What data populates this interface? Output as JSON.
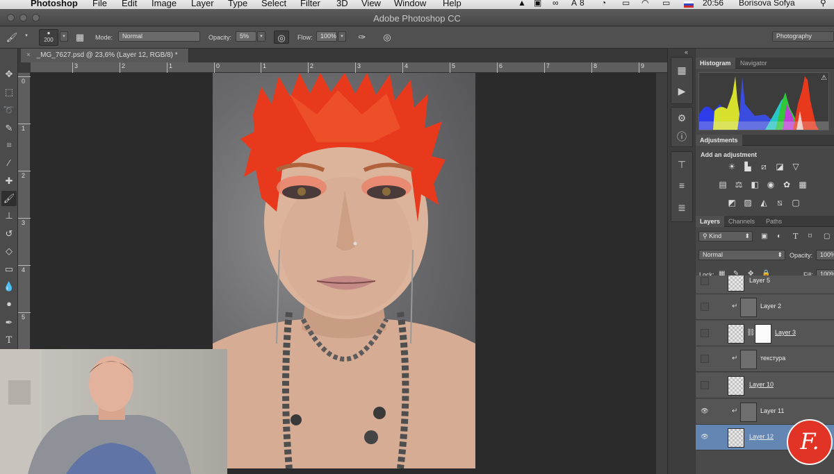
{
  "menubar": {
    "app_name": "Photoshop",
    "menus": [
      "File",
      "Edit",
      "Image",
      "Layer",
      "Type",
      "Select",
      "Filter",
      "3D",
      "View",
      "Window",
      "Help"
    ],
    "status": {
      "badge": "8",
      "time": "20:56",
      "user": "Borisova Sofya"
    }
  },
  "window": {
    "title": "Adobe Photoshop CC"
  },
  "options": {
    "brush_size": "200",
    "mode_label": "Mode:",
    "mode_value": "Normal",
    "opacity_label": "Opacity:",
    "opacity_value": "5%",
    "flow_label": "Flow:",
    "flow_value": "100%",
    "workspace": "Photography"
  },
  "document": {
    "tab_title": "_MG_7627.psd @ 23,6% (Layer 12, RGB/8) *",
    "close": "×"
  },
  "rulers": {
    "horizontal": [
      "3",
      "2",
      "1",
      "0",
      "1",
      "2",
      "3",
      "4",
      "5",
      "6",
      "7",
      "8",
      "9"
    ],
    "vertical": [
      "0",
      "1",
      "2",
      "3",
      "4",
      "5"
    ]
  },
  "tools": [
    "move-icon",
    "marquee-icon",
    "lasso-icon",
    "quick-select-icon",
    "crop-icon",
    "eyedropper-icon",
    "healing-icon",
    "brush-icon",
    "stamp-icon",
    "history-brush-icon",
    "eraser-icon",
    "gradient-icon",
    "blur-icon",
    "dodge-icon",
    "pen-icon",
    "type-icon"
  ],
  "panels": {
    "histogram_tabs": [
      "Histogram",
      "Navigator"
    ],
    "adjustments_tab": "Adjustments",
    "adjustments_title": "Add an adjustment",
    "layers_tabs": [
      "Layers",
      "Channels",
      "Paths"
    ],
    "kind_filter": "Kind",
    "blend_mode": "Normal",
    "opacity_label": "Opacity:",
    "opacity_value": "100%",
    "lock_label": "Lock:",
    "fill_label": "Fill:",
    "fill_value": "100%"
  },
  "layers": [
    {
      "name": "Layer 5",
      "thumb": "checker",
      "visible": false,
      "clipped": false,
      "mask": false,
      "underline": false,
      "selected": false
    },
    {
      "name": "Layer 2",
      "thumb": "gray",
      "visible": false,
      "clipped": true,
      "mask": false,
      "underline": false,
      "selected": false
    },
    {
      "name": "Layer 3",
      "thumb": "checker",
      "visible": false,
      "clipped": false,
      "mask": true,
      "underline": true,
      "selected": false
    },
    {
      "name": "текстура",
      "thumb": "gray",
      "visible": false,
      "clipped": true,
      "mask": false,
      "underline": false,
      "selected": false
    },
    {
      "name": "Layer 10",
      "thumb": "checker",
      "visible": false,
      "clipped": false,
      "mask": false,
      "underline": true,
      "selected": false
    },
    {
      "name": "Layer 11",
      "thumb": "gray",
      "visible": true,
      "clipped": true,
      "mask": false,
      "underline": false,
      "selected": false
    },
    {
      "name": "Layer 12",
      "thumb": "checker",
      "visible": true,
      "clipped": false,
      "mask": false,
      "underline": true,
      "selected": true
    }
  ],
  "logo_text": "F.",
  "colors": {
    "hair": "#e8391d",
    "selection": "#6486b2",
    "logo": "#e23426"
  }
}
